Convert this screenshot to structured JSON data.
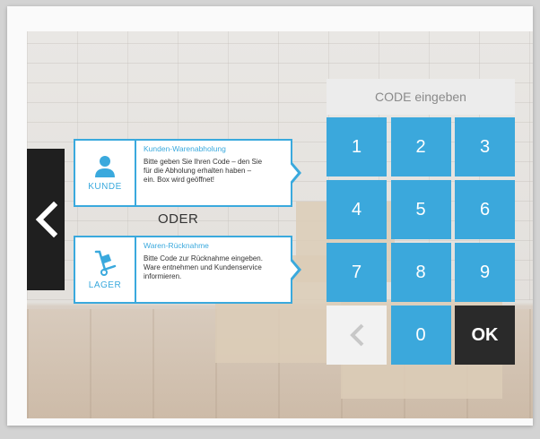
{
  "nav": {
    "back_icon": "chevron-left-icon"
  },
  "cards": {
    "kunde": {
      "icon": "person-icon",
      "icon_label": "KUNDE",
      "title": "Kunden-Warenabholung",
      "desc": "Bitte geben Sie Ihren Code – den Sie\nfür die Abholung erhalten haben –\nein. Box wird geöffnet!"
    },
    "lager": {
      "icon": "hand-truck-icon",
      "icon_label": "LAGER",
      "title": "Waren-Rücknahme",
      "desc": "Bitte Code zur Rücknahme eingeben.\nWare entnehmen und Kundenservice\ninformieren."
    }
  },
  "separator": "ODER",
  "code_display": {
    "placeholder": "CODE eingeben"
  },
  "keypad": {
    "keys": [
      "1",
      "2",
      "3",
      "4",
      "5",
      "6",
      "7",
      "8",
      "9",
      "",
      "0",
      "OK"
    ],
    "backspace_icon": "chevron-left-icon"
  },
  "colors": {
    "accent": "#3ba8dc",
    "dark": "#2a2a2a",
    "tab": "#1f1f1f"
  }
}
